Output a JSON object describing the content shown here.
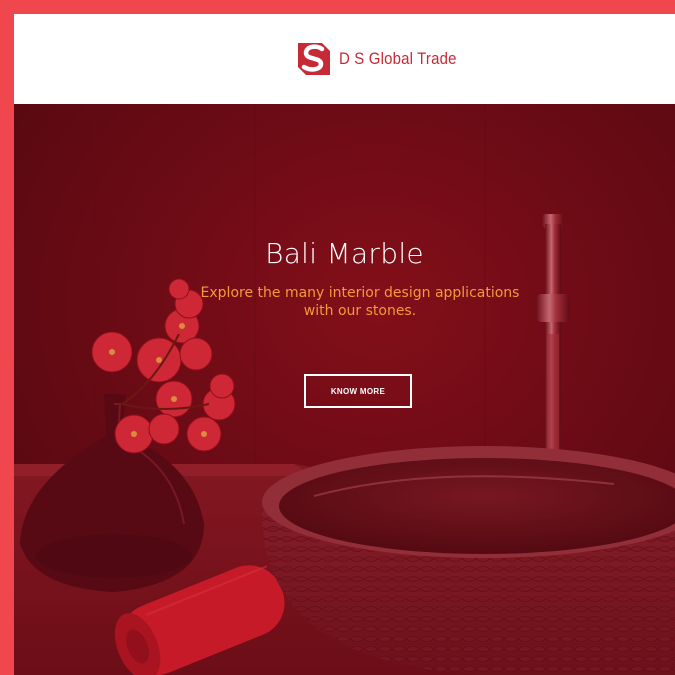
{
  "header": {
    "brand_name": "D S Global Trade",
    "logo_icon": "ds-logo-icon",
    "brand_color": "#c62a37"
  },
  "hero": {
    "title": "Bali Marble",
    "subtitle": "Explore the many interior design applications with our stones.",
    "cta_label": "KNOW MORE",
    "title_color": "#ffffff",
    "subtitle_color": "#f39a3b",
    "overlay_color": "#9b1220"
  },
  "page": {
    "frame_color": "#f0474e"
  }
}
